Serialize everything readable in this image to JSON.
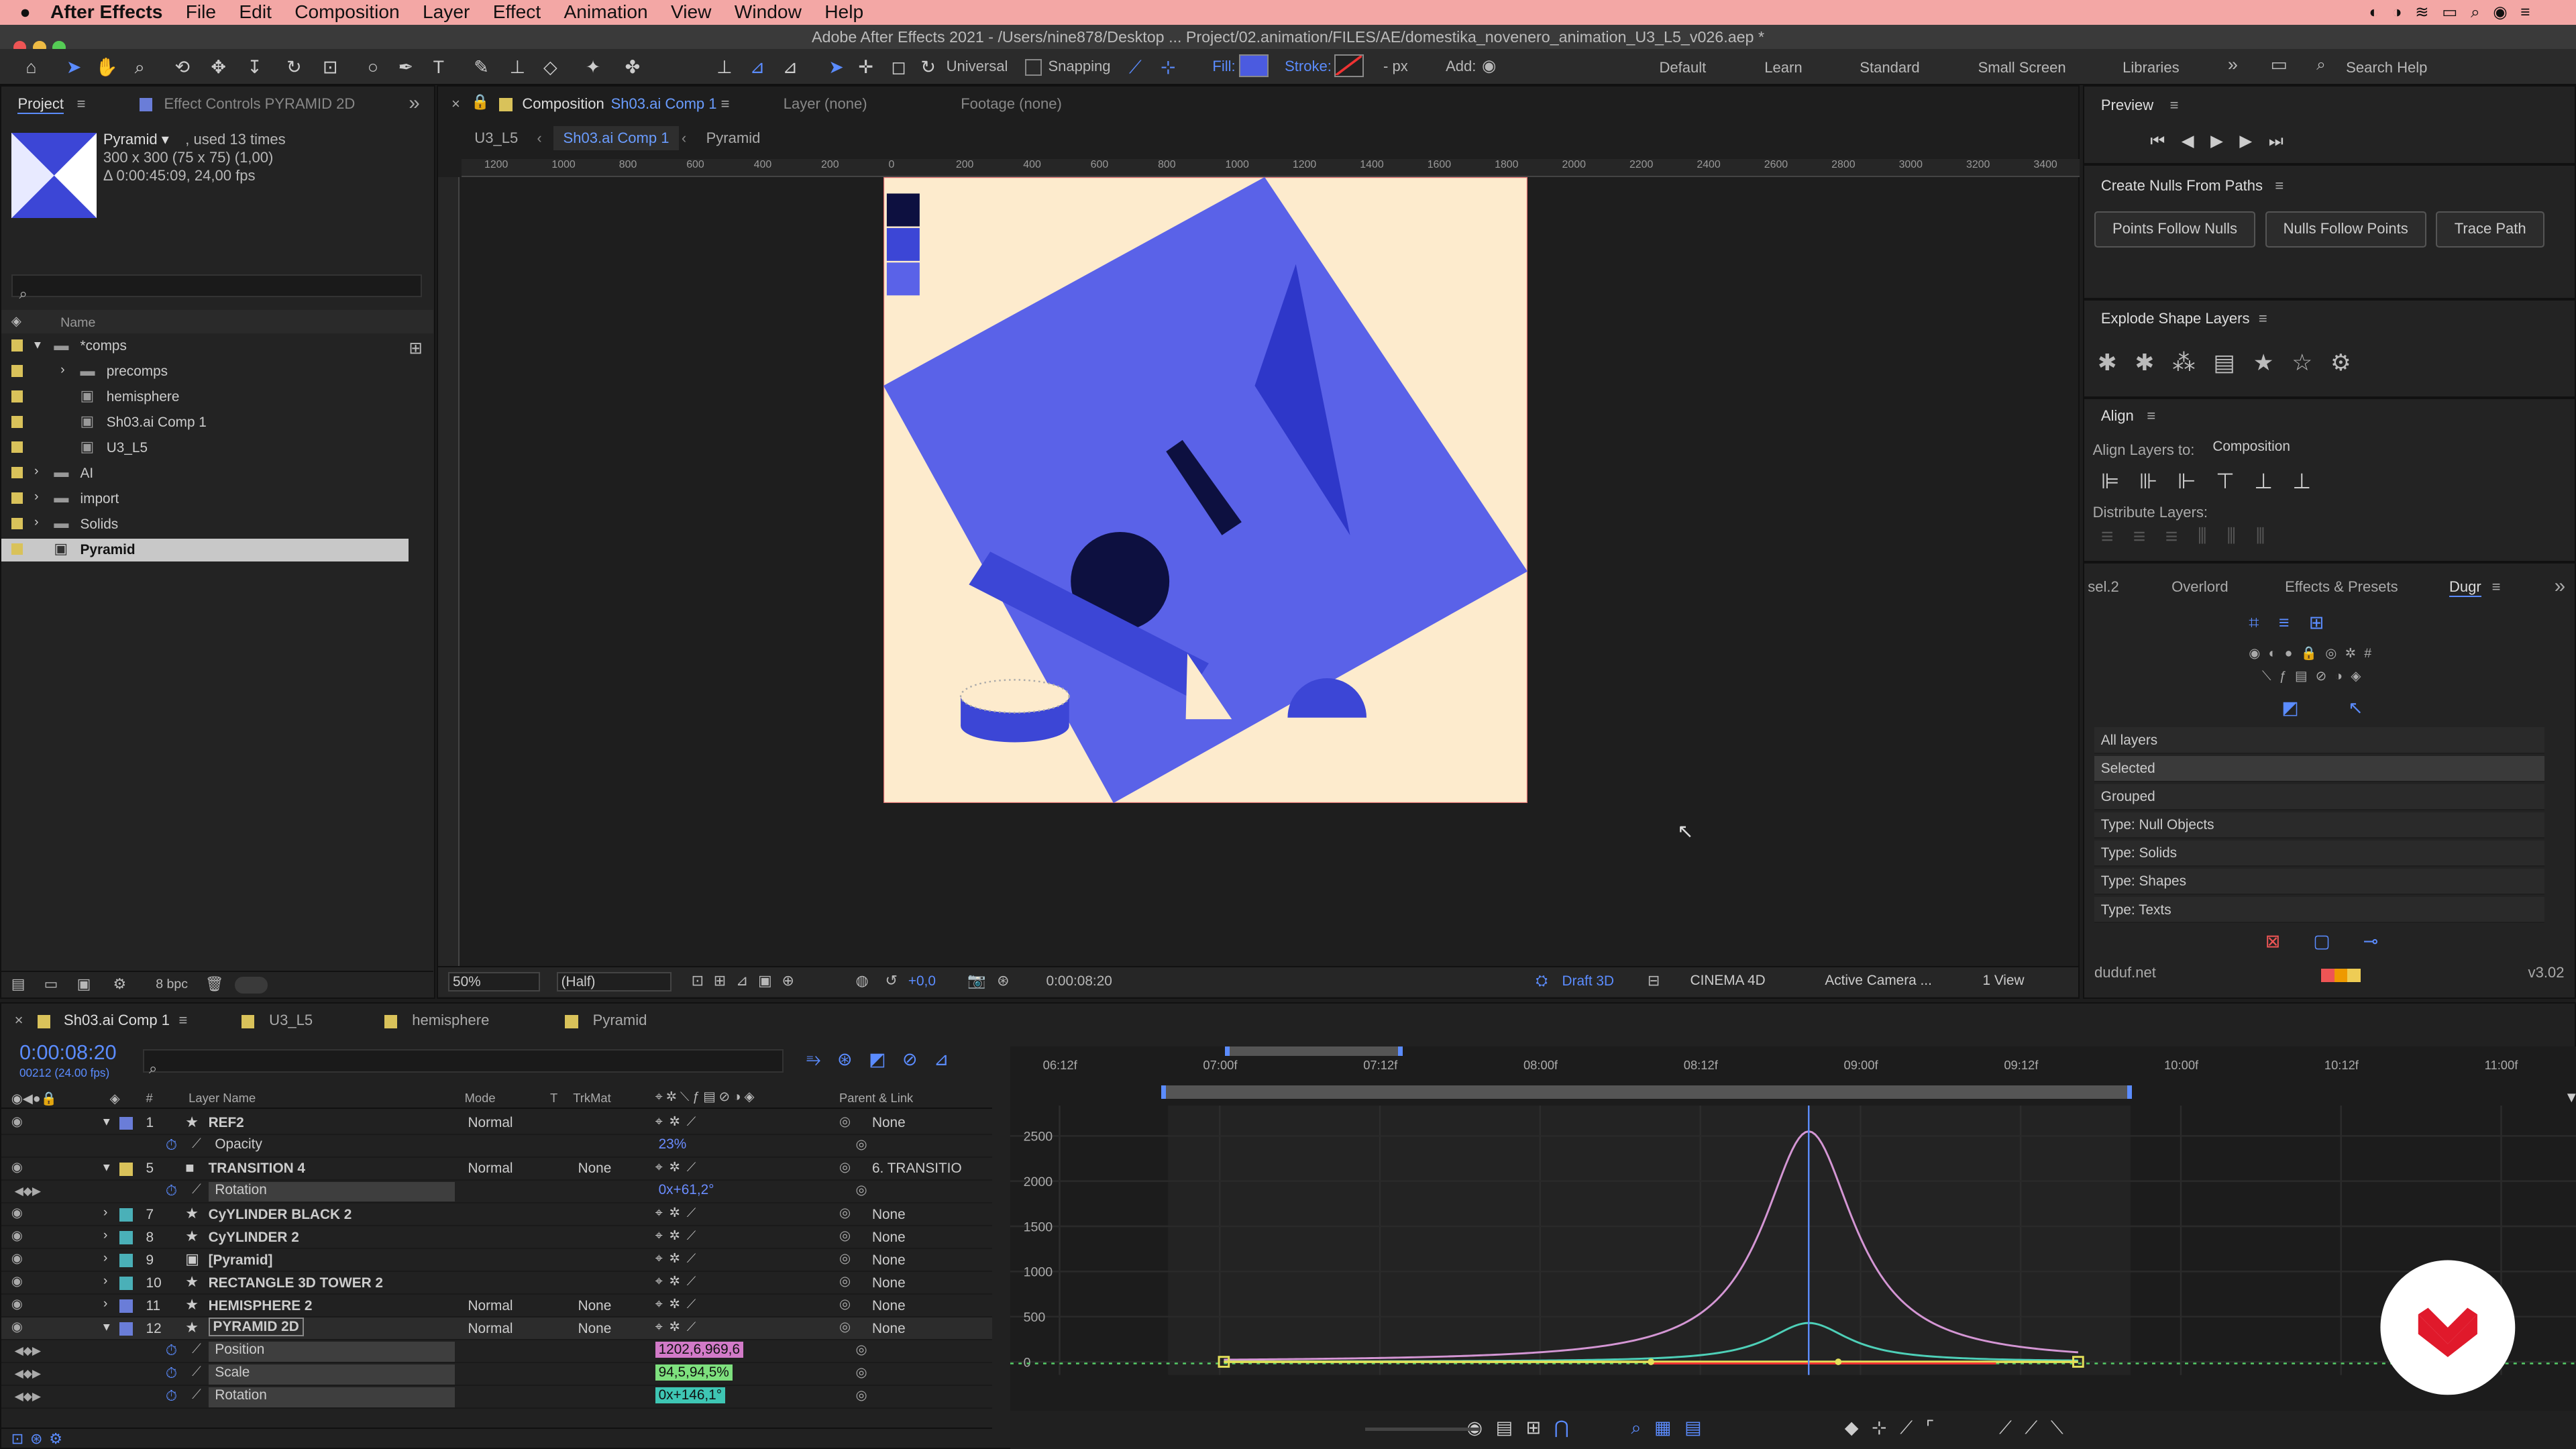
{
  "menubar": {
    "app": "After Effects",
    "items": [
      "File",
      "Edit",
      "Composition",
      "Layer",
      "Effect",
      "Animation",
      "View",
      "Window",
      "Help"
    ]
  },
  "title": "Adobe After Effects 2021 - /Users/nine878/Desktop ... Project/02.animation/FILES/AE/domestika_novenero_animation_U3_L5_v026.aep *",
  "toolbar": {
    "universal": "Universal",
    "snapping": "Snapping",
    "fill": "Fill:",
    "stroke": "Stroke:",
    "px": "- px",
    "add": "Add:",
    "workspaces": [
      "Default",
      "Learn",
      "Standard",
      "Small Screen",
      "Libraries"
    ],
    "search": "Search Help",
    "fill_color": "#4b5be0"
  },
  "project": {
    "tab": "Project",
    "tab2": "Effect Controls PYRAMID 2D",
    "item_name": "Pyramid ▾",
    "item_used": ", used 13 times",
    "item_dims": "300 x 300  (75 x 75) (1,00)",
    "item_dur": "Δ 0:00:45:09, 24,00 fps",
    "col_name": "Name",
    "bpc": "8 bpc",
    "tree": [
      {
        "label": "*comps",
        "depth": 0,
        "type": "folder",
        "color": "#d9c25a",
        "arrow": "v"
      },
      {
        "label": "precomps",
        "depth": 1,
        "type": "folder",
        "color": "#d9c25a",
        "arrow": ">"
      },
      {
        "label": "hemisphere",
        "depth": 1,
        "type": "comp",
        "color": "#d9c25a",
        "arrow": ""
      },
      {
        "label": "Sh03.ai Comp 1",
        "depth": 1,
        "type": "comp",
        "color": "#d9c25a",
        "arrow": ""
      },
      {
        "label": "U3_L5",
        "depth": 1,
        "type": "comp",
        "color": "#d9c25a",
        "arrow": ""
      },
      {
        "label": "AI",
        "depth": 0,
        "type": "folder",
        "color": "#d9c25a",
        "arrow": ">"
      },
      {
        "label": "import",
        "depth": 0,
        "type": "folder",
        "color": "#d9c25a",
        "arrow": ">"
      },
      {
        "label": "Solids",
        "depth": 0,
        "type": "folder",
        "color": "#d9c25a",
        "arrow": ">"
      },
      {
        "label": "Pyramid",
        "depth": 0,
        "type": "comp",
        "color": "#d9c25a",
        "arrow": "",
        "selected": true
      }
    ]
  },
  "comp": {
    "tab_label": "Composition",
    "tab_name": "Sh03.ai Comp 1",
    "layer_tab": "Layer (none)",
    "footage_tab": "Footage (none)",
    "crumbs": [
      "U3_L5",
      "Sh03.ai Comp 1",
      "Pyramid"
    ],
    "ruler": [
      "1200",
      "1000",
      "800",
      "600",
      "400",
      "200",
      "0",
      "200",
      "400",
      "600",
      "800",
      "1000",
      "1200",
      "1400",
      "1600",
      "1800",
      "2000",
      "2200",
      "2400",
      "2600",
      "2800",
      "3000",
      "3200",
      "3400"
    ],
    "zoom": "50%",
    "res": "(Half)",
    "exposure": "+0,0",
    "timecode": "0:00:08:20",
    "draft": "Draft 3D",
    "renderer": "CINEMA 4D",
    "camera": "Active Camera ...",
    "views": "1 View",
    "bg": "#fdebcd",
    "blue": "#5a62e8",
    "navy": "#0d1040"
  },
  "right": {
    "preview": "Preview",
    "nulls_title": "Create Nulls From Paths",
    "nulls_btns": [
      "Points Follow Nulls",
      "Nulls Follow Points",
      "Trace Path"
    ],
    "explode": "Explode Shape Layers",
    "align": "Align",
    "align_to_label": "Align Layers to:",
    "align_to": "Composition",
    "distribute": "Distribute Layers:",
    "tabs": [
      "sel.2",
      "Overlord",
      "Effects & Presets",
      "Dugr"
    ],
    "dugr_list": [
      "All layers",
      "Selected",
      "Grouped",
      "Type: Null Objects",
      "Type: Solids",
      "Type: Shapes",
      "Type: Texts"
    ],
    "footer": "duduf.net",
    "version": "v3.02"
  },
  "timeline": {
    "tabs": [
      "Sh03.ai Comp 1",
      "U3_L5",
      "hemisphere",
      "Pyramid"
    ],
    "tab_colors": [
      "#d9c25a",
      "#d9c25a",
      "#d9c25a",
      "#d9c25a"
    ],
    "time": "0:00:08:20",
    "frame": "00212 (24.00 fps)",
    "headers": {
      "num": "#",
      "name": "Layer Name",
      "mode": "Mode",
      "t": "T",
      "trkmat": "TrkMat",
      "parent": "Parent & Link"
    },
    "rows": [
      {
        "num": "1",
        "name": "REF2",
        "color": "#6a7dd8",
        "mode": "Normal",
        "trk": "",
        "parent": "None",
        "arrow": "v",
        "star": true
      },
      {
        "prop": "Opacity",
        "value": "23%",
        "vcolor": "#6a8cff"
      },
      {
        "num": "5",
        "name": "TRANSITION 4",
        "color": "#d9c25a",
        "mode": "Normal",
        "trk": "None",
        "parent": "6. TRANSITIO",
        "arrow": "v",
        "white": true
      },
      {
        "prop": "Rotation",
        "value": "0x+61,2°",
        "vcolor": "#6a8cff",
        "kf": true
      },
      {
        "num": "7",
        "name": "CyYLINDER BLACK 2",
        "color": "#4ab0b8",
        "mode": "",
        "trk": "",
        "parent": "None",
        "arrow": ">",
        "star": true
      },
      {
        "num": "8",
        "name": "CyYLINDER 2",
        "color": "#4ab0b8",
        "mode": "",
        "trk": "",
        "parent": "None",
        "arrow": ">",
        "star": true
      },
      {
        "num": "9",
        "name": "[Pyramid]",
        "color": "#4ab0b8",
        "mode": "",
        "trk": "",
        "parent": "None",
        "arrow": ">",
        "comp": true
      },
      {
        "num": "10",
        "name": "RECTANGLE 3D TOWER 2",
        "color": "#4ab0b8",
        "mode": "",
        "trk": "",
        "parent": "None",
        "arrow": ">",
        "star": true
      },
      {
        "num": "11",
        "name": "HEMISPHERE 2",
        "color": "#6a7dd8",
        "mode": "Normal",
        "trk": "None",
        "parent": "None",
        "arrow": ">",
        "star": true
      },
      {
        "num": "12",
        "name": "PYRAMID 2D",
        "color": "#6a7dd8",
        "mode": "Normal",
        "trk": "None",
        "parent": "None",
        "arrow": "v",
        "star": true,
        "selected": true
      },
      {
        "prop": "Position",
        "value": "1202,6,969,6",
        "vcolor": "#111",
        "vbg": "#d27ac8",
        "kf": true
      },
      {
        "prop": "Scale",
        "value": "94,5,94,5%",
        "vcolor": "#111",
        "vbg": "#7ee07e",
        "kf": true
      },
      {
        "prop": "Rotation",
        "value": "0x+146,1°",
        "vcolor": "#111",
        "vbg": "#3ec6b4",
        "kf": true
      }
    ],
    "time_ticks": [
      "06:12f",
      "07:00f",
      "07:12f",
      "08:00f",
      "08:12f",
      "09:00f",
      "09:12f",
      "10:00f",
      "10:12f",
      "11:00f"
    ],
    "y_ticks": [
      "2500",
      "2000",
      "1500",
      "1000",
      "500",
      "0"
    ]
  }
}
